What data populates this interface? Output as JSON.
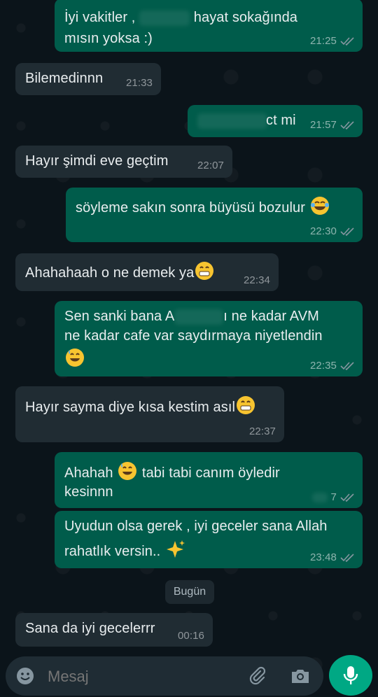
{
  "messages": [
    {
      "dir": "out",
      "lines": [
        "İyi vakitler , ",
        "hayat sokağında",
        "mısın yoksa :)"
      ],
      "time": "21:25",
      "status": "read"
    },
    {
      "dir": "in",
      "text": "Bilemedinnn",
      "time": "21:33"
    },
    {
      "dir": "out",
      "text": "ct mi",
      "time": "21:57",
      "status": "read"
    },
    {
      "dir": "in",
      "text": "Hayır şimdi eve geçtim",
      "time": "22:07"
    },
    {
      "dir": "out",
      "text": "söyleme sakın sonra büyüsü bozulur",
      "time": "22:30",
      "status": "read",
      "emoji": "joy-emoji"
    },
    {
      "dir": "in",
      "text": "Ahahahaah o ne demek ya",
      "time": "22:34",
      "emoji": "grin-emoji"
    },
    {
      "dir": "out",
      "lines": [
        "Sen sanki bana A",
        "ı ne kadar AVM",
        "ne kadar cafe var saydırmaya niyetlendin"
      ],
      "time": "22:35",
      "status": "read",
      "emoji": "sweat-smile-emoji"
    },
    {
      "dir": "in",
      "text": "Hayır sayma diye kısa kestim asıl",
      "time": "22:37",
      "emoji": "grin-emoji"
    },
    {
      "dir": "out",
      "lines": [
        "Ahahah",
        "tabi tabi canım öyledir",
        "kesinnn"
      ],
      "time": "7",
      "status": "read",
      "emoji": "sweat-smile-emoji"
    },
    {
      "dir": "out",
      "lines": [
        "Uyudun olsa gerek , iyi geceler sana Allah",
        "rahatlık versin.."
      ],
      "time": "23:48",
      "status": "read",
      "emoji": "sparkles-emoji"
    },
    {
      "dir": "in",
      "text": "Sana da iyi gecelerrr",
      "time": "00:16"
    }
  ],
  "day_separator": "Bugün",
  "composer": {
    "placeholder": "Mesaj"
  },
  "icons": {
    "emoji": "emoji-icon",
    "attach": "paperclip-icon",
    "camera": "camera-icon",
    "mic": "mic-icon"
  },
  "colors": {
    "outgoing": "#005c4b",
    "incoming": "#202c33",
    "accent": "#00a884",
    "background": "#0b141a"
  }
}
